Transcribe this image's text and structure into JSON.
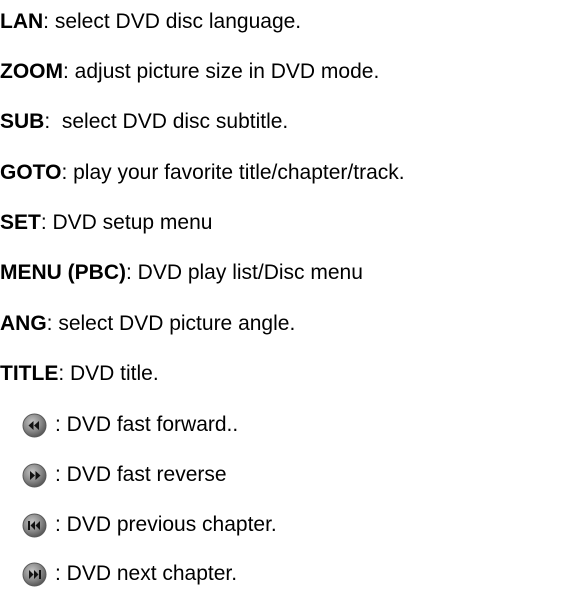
{
  "definitions": [
    {
      "term": "LAN",
      "desc": ": select DVD disc language."
    },
    {
      "term": "ZOOM",
      "desc": ": adjust picture size in DVD mode."
    },
    {
      "term": "SUB",
      "desc": ":  select DVD disc subtitle."
    },
    {
      "term": "GOTO",
      "desc": ": play your favorite title/chapter/track."
    },
    {
      "term": "SET",
      "desc": ": DVD setup menu"
    },
    {
      "term": "MENU (PBC)",
      "desc": ": DVD play list/Disc menu"
    },
    {
      "term": "ANG",
      "desc": ": select DVD picture angle."
    },
    {
      "term": "TITLE",
      "desc": ": DVD title."
    }
  ],
  "icon_items": [
    {
      "icon": "rewind-icon",
      "desc": ": DVD fast forward.."
    },
    {
      "icon": "fast-forward-icon",
      "desc": ": DVD fast reverse"
    },
    {
      "icon": "previous-chapter-icon",
      "desc": ": DVD previous chapter."
    },
    {
      "icon": "next-chapter-icon",
      "desc": ": DVD next chapter."
    }
  ],
  "colors": {
    "text": "#000000",
    "button_fill": "#8a8a8a",
    "button_ring": "#5a5a5a",
    "glyph": "#111111"
  }
}
